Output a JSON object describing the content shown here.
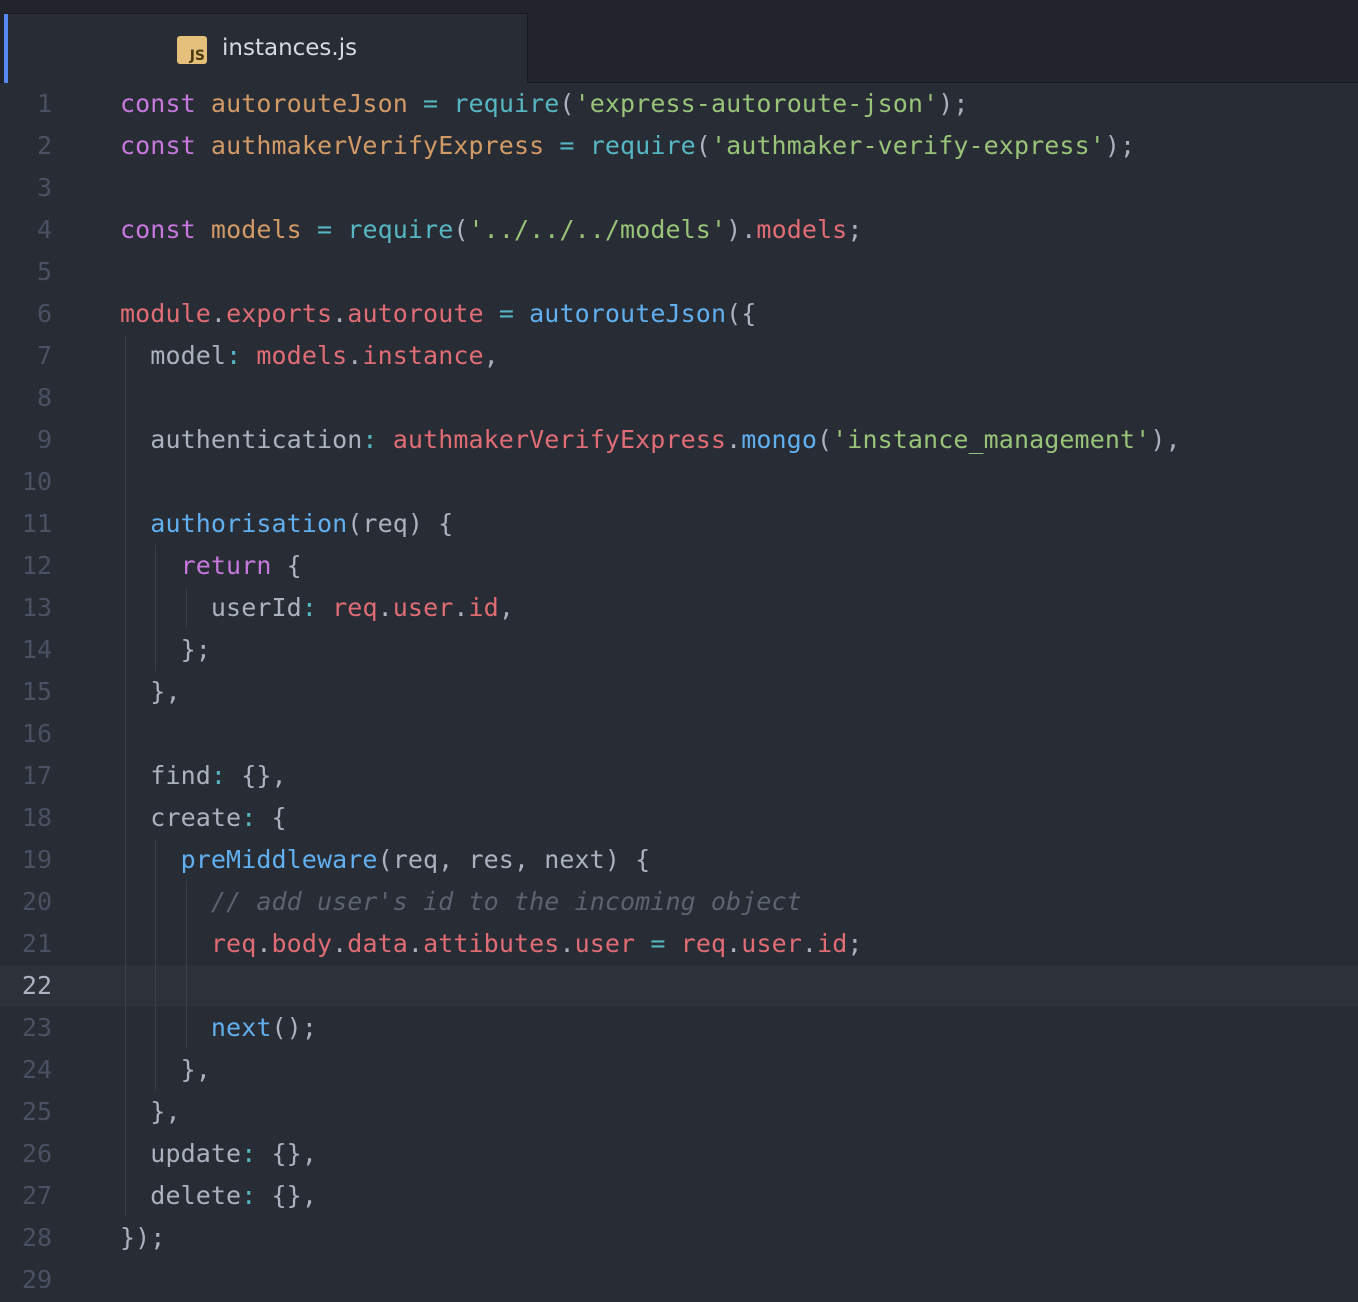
{
  "tab": {
    "icon": "JS",
    "title": "instances.js"
  },
  "editor": {
    "cursor_line": 22,
    "lines": [
      {
        "n": "1",
        "indent": 0,
        "tokens": [
          [
            "keyword",
            "const"
          ],
          [
            "plain",
            " "
          ],
          [
            "def",
            "autorouteJson"
          ],
          [
            "plain",
            " "
          ],
          [
            "operator",
            "="
          ],
          [
            "plain",
            " "
          ],
          [
            "builtin",
            "require"
          ],
          [
            "plain",
            "("
          ],
          [
            "string",
            "'express-autoroute-json'"
          ],
          [
            "plain",
            ");"
          ]
        ]
      },
      {
        "n": "2",
        "indent": 0,
        "tokens": [
          [
            "keyword",
            "const"
          ],
          [
            "plain",
            " "
          ],
          [
            "def",
            "authmakerVerifyExpress"
          ],
          [
            "plain",
            " "
          ],
          [
            "operator",
            "="
          ],
          [
            "plain",
            " "
          ],
          [
            "builtin",
            "require"
          ],
          [
            "plain",
            "("
          ],
          [
            "string",
            "'authmaker-verify-express'"
          ],
          [
            "plain",
            ");"
          ]
        ]
      },
      {
        "n": "3",
        "indent": 0,
        "tokens": []
      },
      {
        "n": "4",
        "indent": 0,
        "tokens": [
          [
            "keyword",
            "const"
          ],
          [
            "plain",
            " "
          ],
          [
            "def",
            "models"
          ],
          [
            "plain",
            " "
          ],
          [
            "operator",
            "="
          ],
          [
            "plain",
            " "
          ],
          [
            "builtin",
            "require"
          ],
          [
            "plain",
            "("
          ],
          [
            "string",
            "'../../../models'"
          ],
          [
            "plain",
            ")."
          ],
          [
            "variable",
            "models"
          ],
          [
            "plain",
            ";"
          ]
        ]
      },
      {
        "n": "5",
        "indent": 0,
        "tokens": []
      },
      {
        "n": "6",
        "indent": 0,
        "tokens": [
          [
            "variable",
            "module"
          ],
          [
            "plain",
            "."
          ],
          [
            "variable",
            "exports"
          ],
          [
            "plain",
            "."
          ],
          [
            "variable",
            "autoroute"
          ],
          [
            "plain",
            " "
          ],
          [
            "operator",
            "="
          ],
          [
            "plain",
            " "
          ],
          [
            "fn",
            "autorouteJson"
          ],
          [
            "plain",
            "({"
          ]
        ]
      },
      {
        "n": "7",
        "indent": 1,
        "tokens": [
          [
            "plain",
            "model"
          ],
          [
            "operator",
            ":"
          ],
          [
            "plain",
            " "
          ],
          [
            "variable",
            "models"
          ],
          [
            "plain",
            "."
          ],
          [
            "variable",
            "instance"
          ],
          [
            "plain",
            ","
          ]
        ]
      },
      {
        "n": "8",
        "indent": 1,
        "tokens": []
      },
      {
        "n": "9",
        "indent": 1,
        "tokens": [
          [
            "plain",
            "authentication"
          ],
          [
            "operator",
            ":"
          ],
          [
            "plain",
            " "
          ],
          [
            "variable",
            "authmakerVerifyExpress"
          ],
          [
            "plain",
            "."
          ],
          [
            "fn",
            "mongo"
          ],
          [
            "plain",
            "("
          ],
          [
            "string",
            "'instance_management'"
          ],
          [
            "plain",
            "),"
          ]
        ]
      },
      {
        "n": "10",
        "indent": 1,
        "tokens": []
      },
      {
        "n": "11",
        "indent": 1,
        "tokens": [
          [
            "fn",
            "authorisation"
          ],
          [
            "plain",
            "(req) {"
          ]
        ]
      },
      {
        "n": "12",
        "indent": 2,
        "tokens": [
          [
            "keyword",
            "return"
          ],
          [
            "plain",
            " {"
          ]
        ]
      },
      {
        "n": "13",
        "indent": 3,
        "tokens": [
          [
            "plain",
            "userId"
          ],
          [
            "operator",
            ":"
          ],
          [
            "plain",
            " "
          ],
          [
            "variable",
            "req"
          ],
          [
            "plain",
            "."
          ],
          [
            "variable",
            "user"
          ],
          [
            "plain",
            "."
          ],
          [
            "variable",
            "id"
          ],
          [
            "plain",
            ","
          ]
        ]
      },
      {
        "n": "14",
        "indent": 2,
        "tokens": [
          [
            "plain",
            "};"
          ]
        ]
      },
      {
        "n": "15",
        "indent": 1,
        "tokens": [
          [
            "plain",
            "},"
          ]
        ]
      },
      {
        "n": "16",
        "indent": 1,
        "tokens": []
      },
      {
        "n": "17",
        "indent": 1,
        "tokens": [
          [
            "plain",
            "find"
          ],
          [
            "operator",
            ":"
          ],
          [
            "plain",
            " {},"
          ]
        ]
      },
      {
        "n": "18",
        "indent": 1,
        "tokens": [
          [
            "plain",
            "create"
          ],
          [
            "operator",
            ":"
          ],
          [
            "plain",
            " {"
          ]
        ]
      },
      {
        "n": "19",
        "indent": 2,
        "tokens": [
          [
            "fn",
            "preMiddleware"
          ],
          [
            "plain",
            "(req, res, next) {"
          ]
        ]
      },
      {
        "n": "20",
        "indent": 3,
        "tokens": [
          [
            "comment",
            "// add user's id to the incoming object"
          ]
        ]
      },
      {
        "n": "21",
        "indent": 3,
        "tokens": [
          [
            "variable",
            "req"
          ],
          [
            "plain",
            "."
          ],
          [
            "variable",
            "body"
          ],
          [
            "plain",
            "."
          ],
          [
            "variable",
            "data"
          ],
          [
            "plain",
            "."
          ],
          [
            "variable",
            "attibutes"
          ],
          [
            "plain",
            "."
          ],
          [
            "variable",
            "user"
          ],
          [
            "plain",
            " "
          ],
          [
            "operator",
            "="
          ],
          [
            "plain",
            " "
          ],
          [
            "variable",
            "req"
          ],
          [
            "plain",
            "."
          ],
          [
            "variable",
            "user"
          ],
          [
            "plain",
            "."
          ],
          [
            "variable",
            "id"
          ],
          [
            "plain",
            ";"
          ]
        ]
      },
      {
        "n": "22",
        "indent": 3,
        "tokens": []
      },
      {
        "n": "23",
        "indent": 3,
        "tokens": [
          [
            "fn",
            "next"
          ],
          [
            "plain",
            "();"
          ]
        ]
      },
      {
        "n": "24",
        "indent": 2,
        "tokens": [
          [
            "plain",
            "},"
          ]
        ]
      },
      {
        "n": "25",
        "indent": 1,
        "tokens": [
          [
            "plain",
            "},"
          ]
        ]
      },
      {
        "n": "26",
        "indent": 1,
        "tokens": [
          [
            "plain",
            "update"
          ],
          [
            "operator",
            ":"
          ],
          [
            "plain",
            " {},"
          ]
        ]
      },
      {
        "n": "27",
        "indent": 1,
        "tokens": [
          [
            "plain",
            "delete"
          ],
          [
            "operator",
            ":"
          ],
          [
            "plain",
            " {},"
          ]
        ]
      },
      {
        "n": "28",
        "indent": 0,
        "tokens": [
          [
            "plain",
            "});"
          ]
        ]
      },
      {
        "n": "29",
        "indent": 0,
        "tokens": []
      }
    ]
  }
}
